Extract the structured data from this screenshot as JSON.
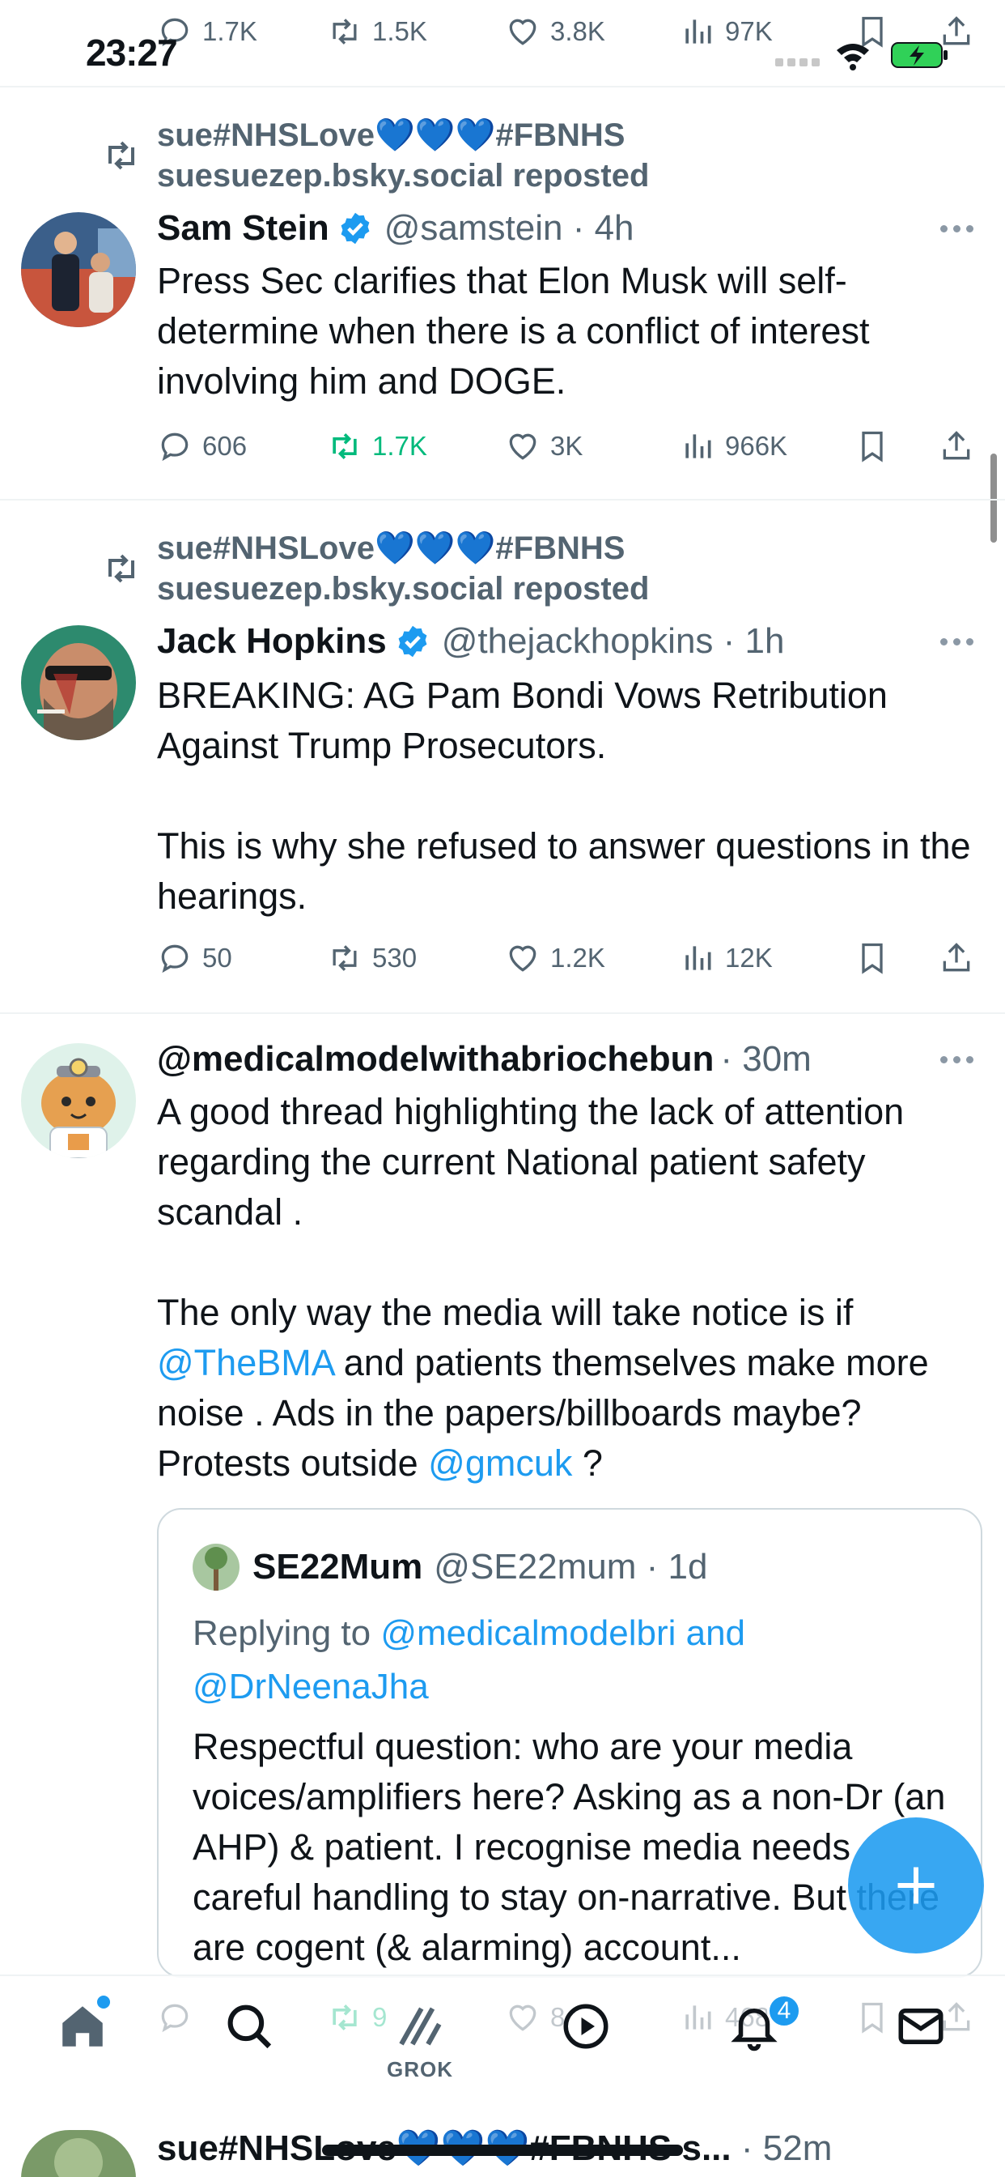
{
  "status_bar": {
    "time": "23:27"
  },
  "top_partial_actions": {
    "replies": "1.7K",
    "reposts": "1.5K",
    "likes": "3.8K",
    "views": "97K"
  },
  "tweets": [
    {
      "repost_by_prefix": "sue#NHSLove",
      "repost_hearts": "💙💙💙",
      "repost_by_suffix": "#FBNHS",
      "repost_line2": "suesuezep.bsky.social reposted",
      "name": "Sam Stein",
      "handle": "@samstein · 4h",
      "text": "Press Sec clarifies that Elon Musk will self-determine when there is a conflict of interest involving him and DOGE.",
      "replies": "606",
      "reposts": "1.7K",
      "likes": "3K",
      "views": "966K"
    },
    {
      "repost_by_prefix": "sue#NHSLove",
      "repost_hearts": "💙💙💙",
      "repost_by_suffix": "#FBNHS",
      "repost_line2": "suesuezep.bsky.social reposted",
      "name": "Jack Hopkins",
      "handle": "@thejackhopkins · 1h",
      "text_p1": "BREAKING: AG Pam Bondi Vows Retribution Against Trump Prosecutors.",
      "text_p2": "This is why she refused to answer questions in the hearings.",
      "replies": "50",
      "reposts": "530",
      "likes": "1.2K",
      "views": "12K"
    },
    {
      "name": "@medicalmodelwithabriochebun",
      "time": "· 30m",
      "text_p1": "A good thread highlighting the lack of attention regarding the current National patient safety scandal .",
      "text_p2_a": "The only way the media will take notice is if ",
      "mention1": "@TheBMA",
      "text_p2_b": " and patients themselves make more noise . Ads in the papers/billboards maybe? Protests outside ",
      "mention2": "@gmcuk",
      "text_p2_c": " ?",
      "quote": {
        "name": "SE22Mum",
        "handle": "@SE22mum · 1d",
        "replying_prefix": "Replying to ",
        "replying_to": "@medicalmodelbri and @DrNeenaJha",
        "text": "Respectful question: who are your media voices/amplifiers here? Asking as a non-Dr (an AHP) & patient. I recognise media needs careful handling to stay on-narrative. But there are cogent (& alarming) account..."
      },
      "ghost_reposts": "9",
      "ghost_likes": "8",
      "ghost_views": "468"
    }
  ],
  "tab_bar": {
    "grok_label": "GROK",
    "notifications_badge": "4"
  },
  "next_tweet_peek": {
    "name": "sue#NHSLove💙💙💙#FBNHS s...",
    "time": "· 52m"
  },
  "colors": {
    "accent": "#1d9bf0",
    "repost_green": "#00ba7c",
    "muted": "#536471"
  }
}
